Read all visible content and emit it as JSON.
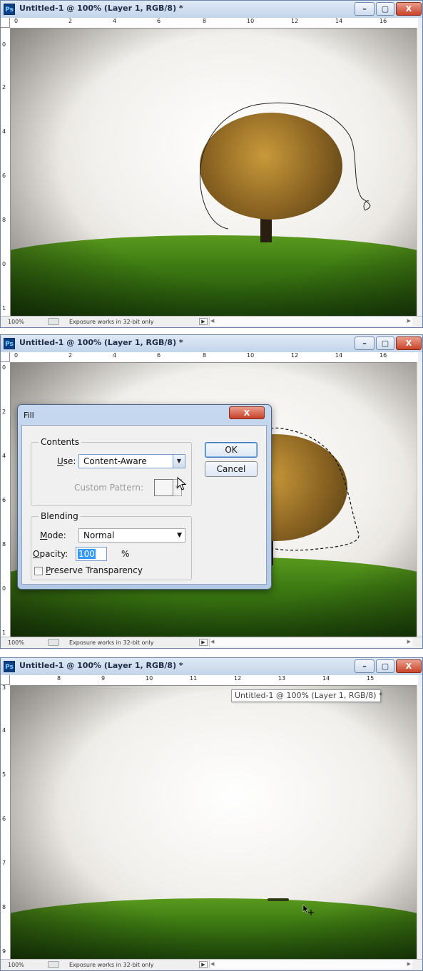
{
  "window_title": "Untitled-1 @ 100% (Layer 1, RGB/8) *",
  "app_icon_text": "Ps",
  "window_buttons": {
    "minimize": "–",
    "maximize": "▢",
    "close": "X"
  },
  "status": {
    "zoom": "100%",
    "message": "Exposure works in 32-bit only",
    "arrow": "▶"
  },
  "panel1": {
    "hruler": [
      "0",
      "2",
      "4",
      "6",
      "8",
      "10",
      "12",
      "14",
      "16"
    ],
    "vruler": [
      "0",
      "2",
      "4",
      "6",
      "8",
      "0",
      "1"
    ]
  },
  "panel2": {
    "hruler": [
      "0",
      "2",
      "4",
      "6",
      "8",
      "10",
      "12",
      "14",
      "16"
    ],
    "vruler": [
      "0",
      "2",
      "4",
      "6",
      "8",
      "0",
      "1"
    ]
  },
  "panel3": {
    "hruler": [
      "8",
      "9",
      "10",
      "11",
      "12",
      "13",
      "14",
      "15"
    ],
    "vruler": [
      "3",
      "4",
      "5",
      "6",
      "7",
      "8",
      "9"
    ],
    "tooltip": "Untitled-1 @ 100% (Layer 1, RGB/8) *"
  },
  "fill_dialog": {
    "title": "Fill",
    "close": "X",
    "contents_group": "Contents",
    "use_label_u": "U",
    "use_label_rest": "se:",
    "use_value": "Content-Aware",
    "custom_pattern_label": "Custom Pattern:",
    "blending_group": "Blending",
    "mode_label_u": "M",
    "mode_label_rest": "ode:",
    "mode_value": "Normal",
    "opacity_label_u": "O",
    "opacity_label_rest": "pacity:",
    "opacity_value": "100",
    "opacity_unit": "%",
    "preserve_u": "P",
    "preserve_rest": "reserve Transparency",
    "ok": "OK",
    "cancel": "Cancel"
  }
}
